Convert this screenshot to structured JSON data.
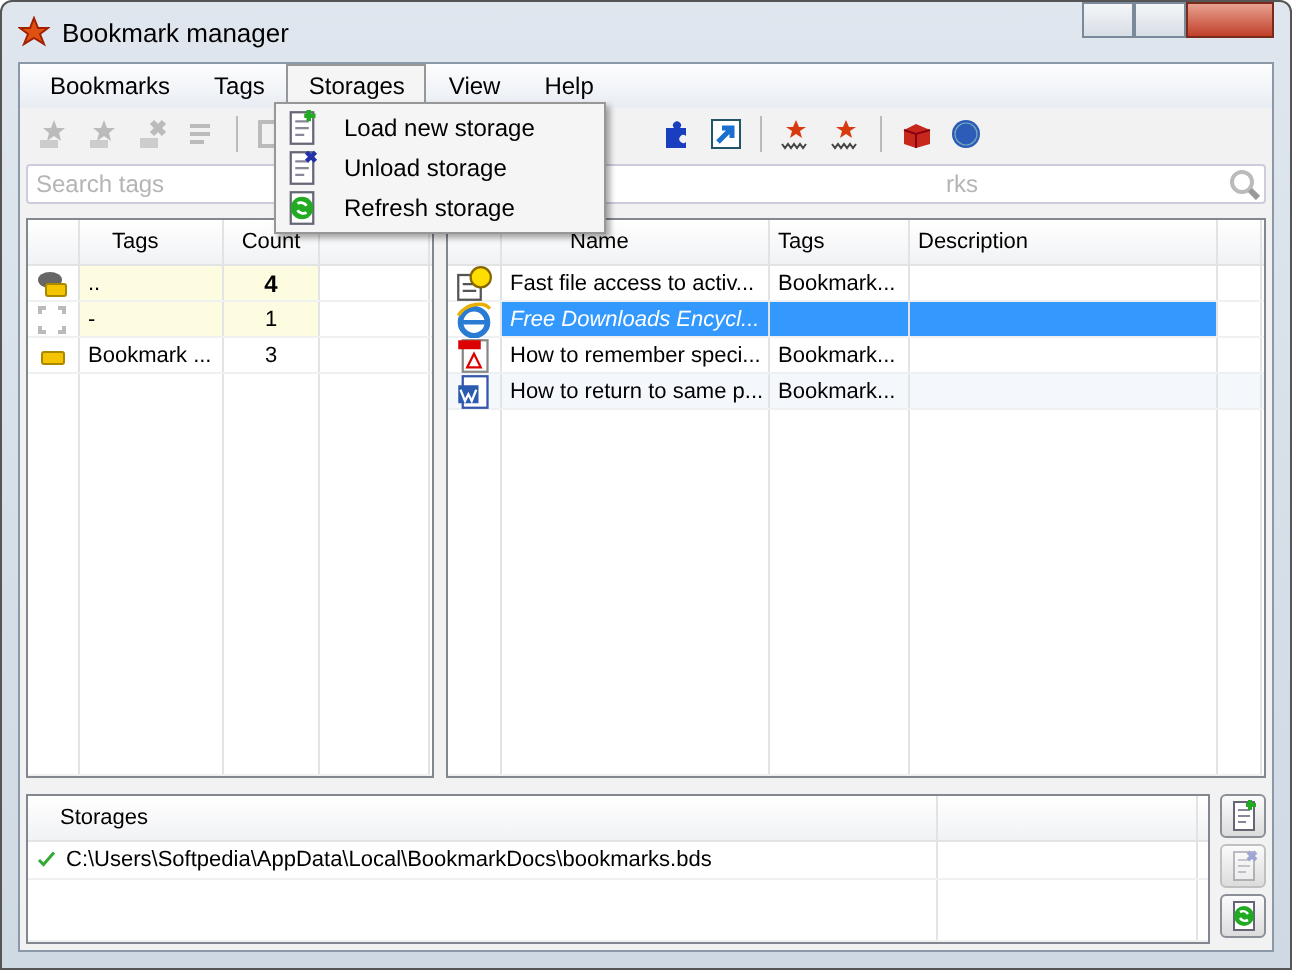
{
  "window": {
    "title": "Bookmark manager"
  },
  "menu": [
    {
      "label": "Bookmarks",
      "selected": false
    },
    {
      "label": "Tags",
      "selected": false
    },
    {
      "label": "Storages",
      "selected": true
    },
    {
      "label": "View",
      "selected": false
    },
    {
      "label": "Help",
      "selected": false
    }
  ],
  "dropdown": [
    {
      "kind": "load",
      "label": "Load new storage"
    },
    {
      "kind": "unload",
      "label": "Unload storage"
    },
    {
      "kind": "refresh",
      "label": "Refresh storage"
    }
  ],
  "tag_search": {
    "placeholder": "Search tags"
  },
  "bookmark_search": {
    "placeholder": "rks"
  },
  "tags_table": {
    "columns": [
      "Tags",
      "Count"
    ],
    "rows": [
      {
        "kind": "all",
        "tag": "..",
        "count": "4",
        "highlighted": true,
        "bold": true
      },
      {
        "kind": "none",
        "tag": "-",
        "count": "1",
        "highlighted": true,
        "bold": false
      },
      {
        "kind": "tag",
        "tag": "Bookmark ...",
        "count": "3",
        "highlighted": false,
        "bold": false
      }
    ]
  },
  "bookmarks_table": {
    "columns": [
      "Name",
      "Tags",
      "Description"
    ],
    "rows": [
      {
        "kind": "help",
        "name": "Fast file access to activ...",
        "tags": "Bookmark...",
        "selected": false
      },
      {
        "kind": "web",
        "name": "Free Downloads Encycl...",
        "tags": "",
        "selected": true
      },
      {
        "kind": "pdf",
        "name": "How to remember speci...",
        "tags": "Bookmark...",
        "selected": false
      },
      {
        "kind": "word",
        "name": "How to return to same p...",
        "tags": "Bookmark...",
        "selected": false
      }
    ]
  },
  "storages": {
    "column": "Storages",
    "rows": [
      {
        "path": "C:\\Users\\Softpedia\\AppData\\Local\\BookmarkDocs\\bookmarks.bds",
        "active": true
      }
    ],
    "buttons": [
      {
        "kind": "load",
        "disabled": false
      },
      {
        "kind": "unload",
        "disabled": true
      },
      {
        "kind": "refresh",
        "disabled": false
      }
    ]
  }
}
